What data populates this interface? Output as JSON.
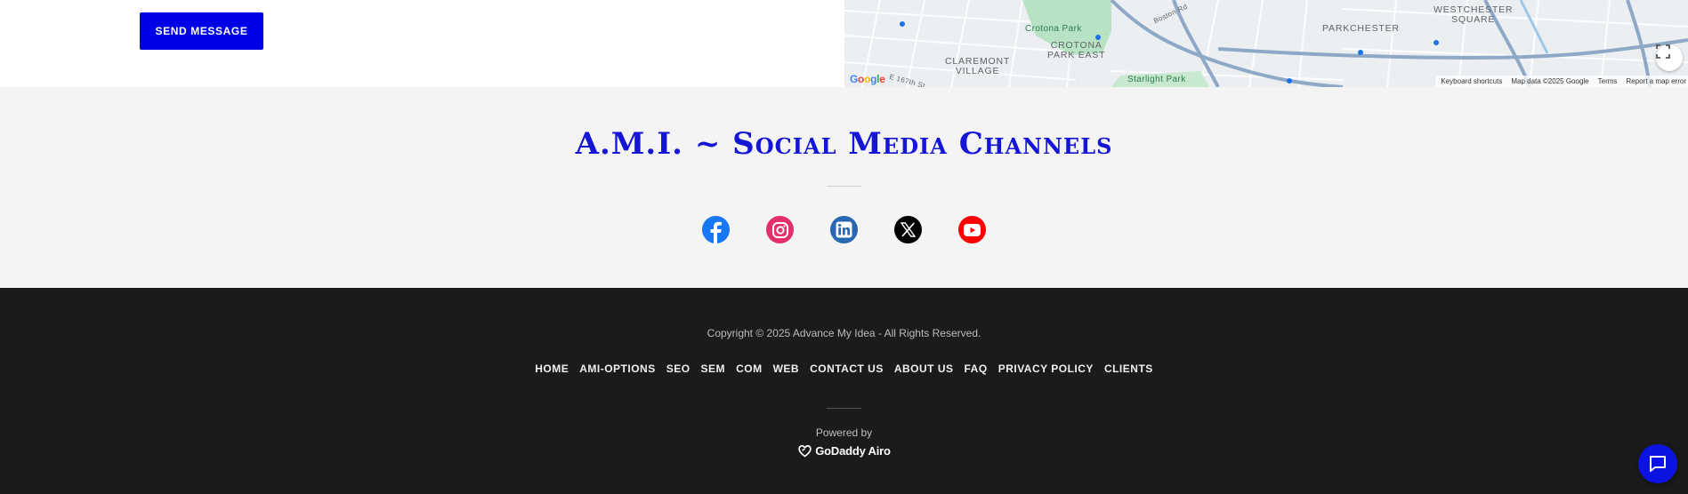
{
  "contact": {
    "send_label": "SEND MESSAGE"
  },
  "map": {
    "labels": {
      "crotona_park": "Crotona Park",
      "crotona_park_east": "CROTONA\nPARK EAST",
      "claremont_village": "CLAREMONT\nVILLAGE",
      "parkchester": "PARKCHESTER",
      "westchester_square": "WESTCHESTER\nSQUARE",
      "starlight_park": "Starlight Park",
      "boston_rd": "Boston Rd",
      "e_167th": "E 167th St"
    },
    "google": "Google",
    "footer": {
      "shortcuts": "Keyboard shortcuts",
      "map_data": "Map data ©2025 Google",
      "terms": "Terms",
      "report": "Report a map error"
    }
  },
  "social": {
    "title": "A.M.I. ~ Social Media Channels",
    "icons": [
      {
        "name": "facebook-icon",
        "color": "#1877f2"
      },
      {
        "name": "instagram-icon",
        "color": "#e1306c"
      },
      {
        "name": "linkedin-icon",
        "color": "#2867b2"
      },
      {
        "name": "x-icon",
        "color": "#000000"
      },
      {
        "name": "youtube-icon",
        "color": "#ff0000"
      }
    ]
  },
  "footer": {
    "copyright": "Copyright © 2025 Advance My Idea - All Rights Reserved.",
    "nav": [
      "HOME",
      "AMI-OPTIONS",
      "SEO",
      "SEM",
      "COM",
      "WEB",
      "CONTACT US",
      "ABOUT US",
      "FAQ",
      "PRIVACY POLICY",
      "CLIENTS"
    ],
    "powered_by": "Powered by",
    "brand": "GoDaddy Airo"
  },
  "colors": {
    "accent": "#0000e6",
    "footer_bg": "#1b1b1b",
    "section_bg": "#f4f4f4"
  }
}
